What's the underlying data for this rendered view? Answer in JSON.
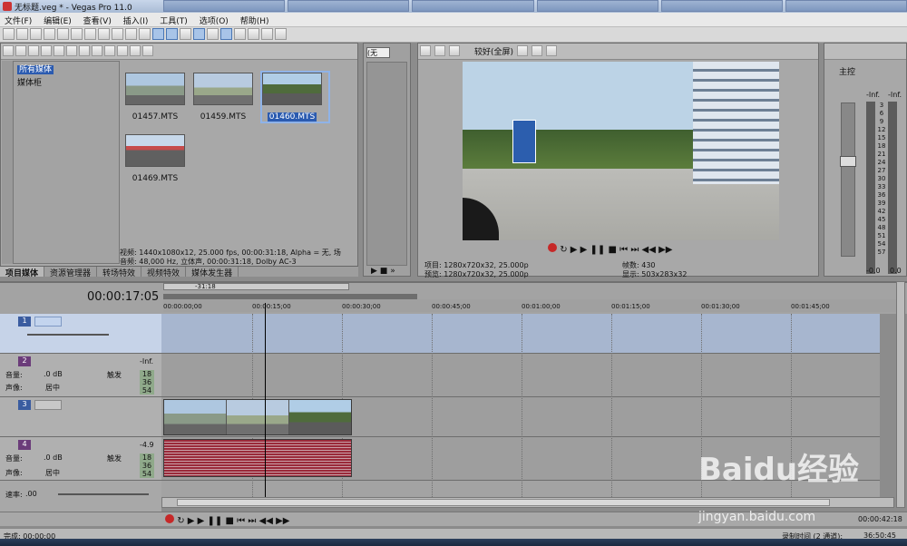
{
  "window": {
    "title": "无标题.veg * - Vegas Pro 11.0"
  },
  "menu": [
    "文件(F)",
    "编辑(E)",
    "查看(V)",
    "插入(I)",
    "工具(T)",
    "选项(O)",
    "帮助(H)"
  ],
  "project_media": {
    "tree": [
      "所有媒体",
      "媒体柜"
    ],
    "files": [
      "01457.MTS",
      "01459.MTS",
      "01460.MTS",
      "01469.MTS"
    ],
    "selected_file": "01460.MTS",
    "info_line1": "视频: 1440x1080x12, 25.000 fps, 00:00:31:18, Alpha = 无, 场",
    "info_line2": "音频: 48,000 Hz, 立体声, 00:00:31:18, Dolby AC-3",
    "tabs": [
      "项目媒体",
      "资源管理器",
      "转场特效",
      "视频特效",
      "媒体发生器"
    ]
  },
  "trimmer": {
    "dropdown": "(无"
  },
  "preview": {
    "quality": "较好(全屏)",
    "project_label": "项目:",
    "project_value": "1280x720x32, 25.000p",
    "preview_label": "预览:",
    "preview_value": "1280x720x32, 25.000p",
    "frame_label": "帧数:",
    "frame_value": "430",
    "display_label": "显示:",
    "display_value": "503x283x32"
  },
  "mixer": {
    "title": "主控",
    "scale": [
      "-Inf.",
      "3",
      "6",
      "9",
      "12",
      "15",
      "18",
      "21",
      "24",
      "27",
      "30",
      "33",
      "36",
      "39",
      "42",
      "45",
      "48",
      "51",
      "54",
      "57"
    ],
    "left_value": "-0.0",
    "right_value": "0.0",
    "left_inf": "-Inf.",
    "right_inf": "-Inf."
  },
  "timeline": {
    "current_time": "00:00:17:05",
    "loop_marker": "-31:18",
    "ruler": [
      "00:00:00;00",
      "00:00:15;00",
      "00:00:30;00",
      "00:00:45;00",
      "00:01:00;00",
      "00:01:15;00",
      "00:01:30;00",
      "00:01:45;00"
    ],
    "tracks": [
      {
        "num": "1",
        "type": "video"
      },
      {
        "num": "2",
        "type": "audio",
        "vol_label": "音量:",
        "vol": ".0 dB",
        "pan_label": "声像:",
        "pan": "居中",
        "mode": "触发",
        "meter": [
          "18",
          "36",
          "54"
        ],
        "inf": "-Inf."
      },
      {
        "num": "3",
        "type": "video"
      },
      {
        "num": "4",
        "type": "audio",
        "vol_label": "音量:",
        "vol": ".0 dB",
        "pan_label": "声像:",
        "pan": "居中",
        "mode": "触发",
        "meter": [
          "18",
          "36",
          "54"
        ],
        "inf": "-4.9"
      }
    ],
    "rate_label": "速率:",
    "rate": ".00",
    "end_time": "00:00:42:18"
  },
  "status": {
    "left": "完成: 00:00:00",
    "right_label": "录制时间 (2 通道):",
    "right_value": "36:50:45"
  },
  "watermark": {
    "logo": "Baidu经验",
    "url": "jingyan.baidu.com"
  }
}
